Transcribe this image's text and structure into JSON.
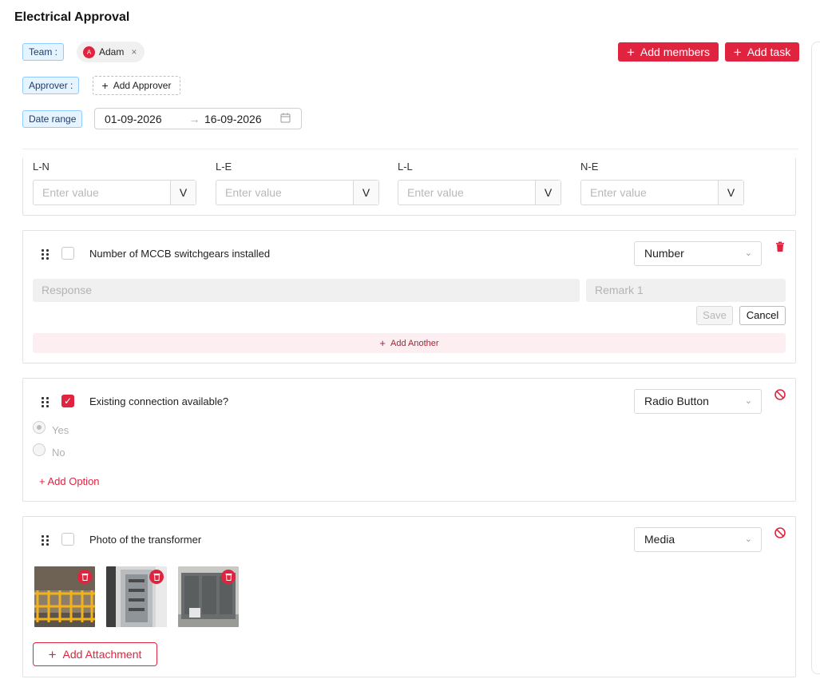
{
  "page": {
    "title": "Electrical Approval"
  },
  "header": {
    "team_label": "Team :",
    "team_member": {
      "initial": "A",
      "name": "Adam",
      "remove": "×"
    },
    "approver_label": "Approver :",
    "add_approver": "Add Approver",
    "date_range_label": "Date range",
    "date_start": "01-09-2026",
    "date_end": "16-09-2026",
    "add_members": "Add members",
    "add_task": "Add task"
  },
  "voltage": {
    "fields": [
      {
        "label": "L-N",
        "placeholder": "Enter value",
        "unit": "V"
      },
      {
        "label": "L-E",
        "placeholder": "Enter value",
        "unit": "V"
      },
      {
        "label": "L-L",
        "placeholder": "Enter value",
        "unit": "V"
      },
      {
        "label": "N-E",
        "placeholder": "Enter value",
        "unit": "V"
      }
    ]
  },
  "q1": {
    "text": "Number of MCCB switchgears installed",
    "type": "Number",
    "checked": false,
    "response_placeholder": "Response",
    "remark_placeholder": "Remark 1",
    "save": "Save",
    "cancel": "Cancel",
    "add_another": "Add Another"
  },
  "q2": {
    "text": "Existing connection available?",
    "type": "Radio Button",
    "checked": true,
    "options": [
      {
        "label": "Yes",
        "selected": true
      },
      {
        "label": "No",
        "selected": false
      }
    ],
    "add_option": "+ Add Option"
  },
  "q3": {
    "text": "Photo of the transformer",
    "type": "Media",
    "checked": false,
    "attachments": 3,
    "add_attachment": "Add Attachment"
  },
  "colors": {
    "accent": "#e0243f",
    "tag_bg": "#e6f4ff",
    "tag_border": "#91caff"
  }
}
